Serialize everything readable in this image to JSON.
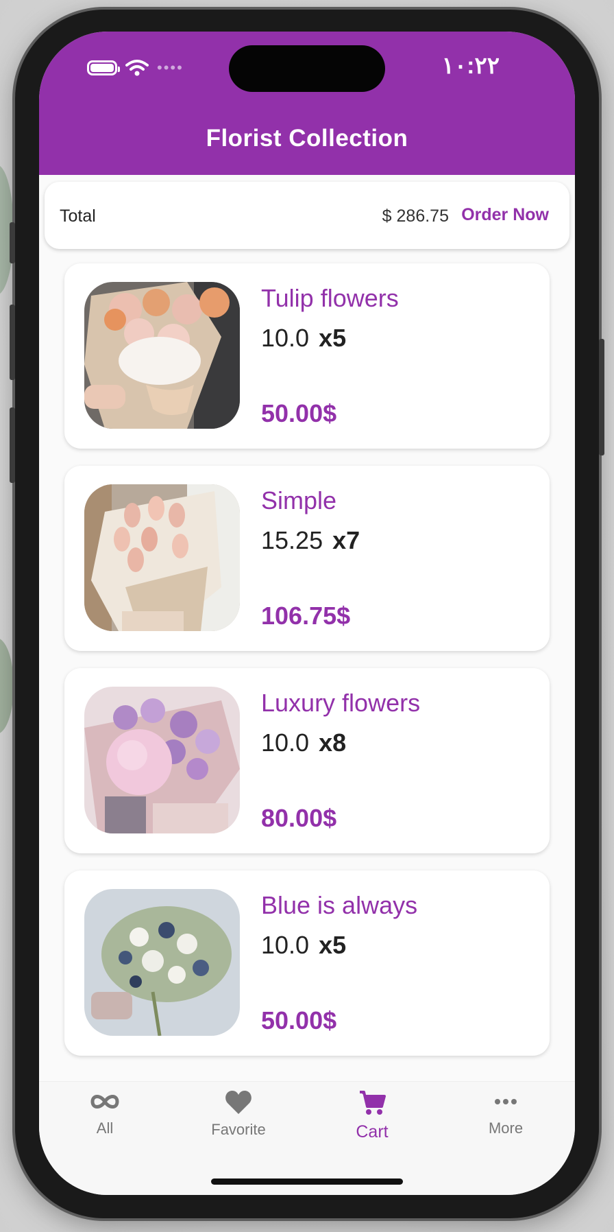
{
  "status_bar": {
    "time": "١٠:٢٢"
  },
  "header": {
    "title": "Florist Collection"
  },
  "summary": {
    "total_label": "Total",
    "total_amount": "$ 286.75",
    "order_button": "Order Now"
  },
  "cart_items": [
    {
      "name": "Tulip flowers",
      "unit_price": "10.0",
      "quantity": "x5",
      "line_total": "50.00$"
    },
    {
      "name": "Simple",
      "unit_price": "15.25",
      "quantity": "x7",
      "line_total": "106.75$"
    },
    {
      "name": "Luxury flowers",
      "unit_price": "10.0",
      "quantity": "x8",
      "line_total": "80.00$"
    },
    {
      "name": "Blue is always",
      "unit_price": "10.0",
      "quantity": "x5",
      "line_total": "50.00$"
    }
  ],
  "bottom_nav": [
    {
      "label": "All",
      "icon": "infinity-icon"
    },
    {
      "label": "Favorite",
      "icon": "heart-icon"
    },
    {
      "label": "Cart",
      "icon": "cart-icon",
      "active": true
    },
    {
      "label": "More",
      "icon": "more-dots-icon"
    }
  ],
  "colors": {
    "primary": "#9231aa",
    "text": "#222222",
    "background": "#fafafa"
  }
}
